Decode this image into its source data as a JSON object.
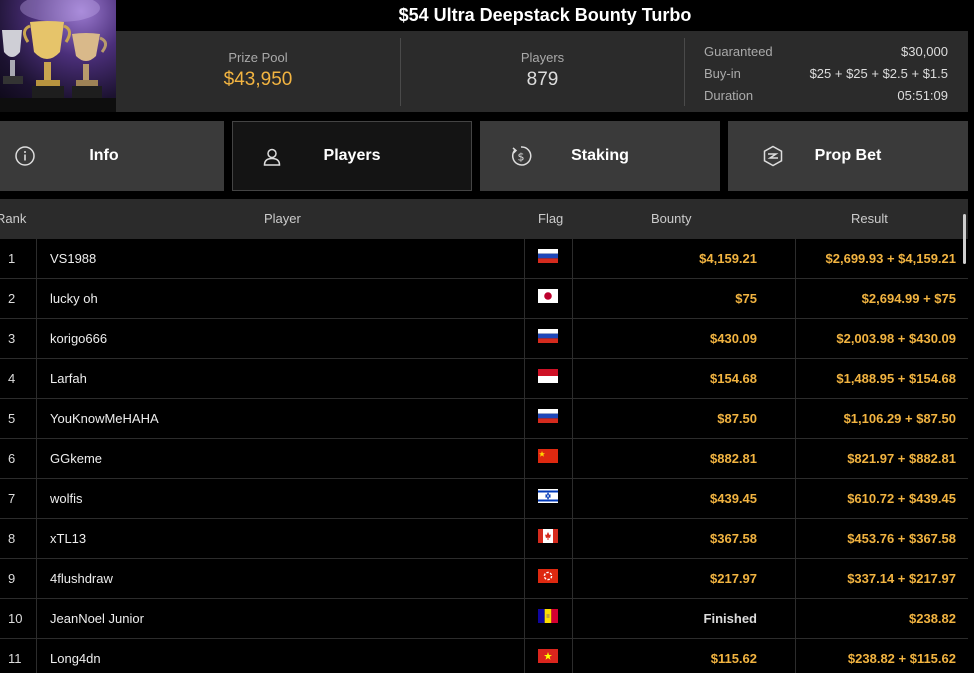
{
  "title": "$54 Ultra Deepstack Bounty Turbo",
  "stats": {
    "prize_pool_label": "Prize Pool",
    "prize_pool_value": "$43,950",
    "players_label": "Players",
    "players_value": "879",
    "guaranteed_label": "Guaranteed",
    "guaranteed_value": "$30,000",
    "buyin_label": "Buy-in",
    "buyin_value": "$25 + $25 + $2.5 + $1.5",
    "duration_label": "Duration",
    "duration_value": "05:51:09"
  },
  "tabs": [
    {
      "label": "Info",
      "icon": "info-icon"
    },
    {
      "label": "Players",
      "icon": "user-icon"
    },
    {
      "label": "Staking",
      "icon": "dollar-coin-icon"
    },
    {
      "label": "Prop Bet",
      "icon": "prop-bet-icon"
    }
  ],
  "table": {
    "headers": {
      "rank": "Rank",
      "player": "Player",
      "flag": "Flag",
      "bounty": "Bounty",
      "result": "Result"
    },
    "rows": [
      {
        "rank": "1",
        "player": "VS1988",
        "flag": "russia",
        "bounty": "$4,159.21",
        "result": "$2,699.93 + $4,159.21"
      },
      {
        "rank": "2",
        "player": "lucky oh",
        "flag": "japan",
        "bounty": "$75",
        "result": "$2,694.99 + $75"
      },
      {
        "rank": "3",
        "player": "korigo666",
        "flag": "russia",
        "bounty": "$430.09",
        "result": "$2,003.98 + $430.09"
      },
      {
        "rank": "4",
        "player": "Larfah",
        "flag": "indonesia",
        "bounty": "$154.68",
        "result": "$1,488.95 + $154.68"
      },
      {
        "rank": "5",
        "player": "YouKnowMeHAHA",
        "flag": "russia",
        "bounty": "$87.50",
        "result": "$1,106.29 + $87.50"
      },
      {
        "rank": "6",
        "player": "GGkeme",
        "flag": "china",
        "bounty": "$882.81",
        "result": "$821.97 + $882.81"
      },
      {
        "rank": "7",
        "player": "wolfis",
        "flag": "israel",
        "bounty": "$439.45",
        "result": "$610.72 + $439.45"
      },
      {
        "rank": "8",
        "player": "xTL13",
        "flag": "canada",
        "bounty": "$367.58",
        "result": "$453.76 + $367.58"
      },
      {
        "rank": "9",
        "player": "4flushdraw",
        "flag": "hong-kong",
        "bounty": "$217.97",
        "result": "$337.14 + $217.97"
      },
      {
        "rank": "10",
        "player": "JeanNoel Junior",
        "flag": "andorra",
        "bounty": "Finished",
        "result": "$238.82"
      },
      {
        "rank": "11",
        "player": "Long4dn",
        "flag": "vietnam",
        "bounty": "$115.62",
        "result": "$238.82 + $115.62"
      }
    ]
  },
  "colors": {
    "accent": "#f2b441",
    "panel": "#2b2b2b",
    "tab": "#3a3a3a"
  }
}
